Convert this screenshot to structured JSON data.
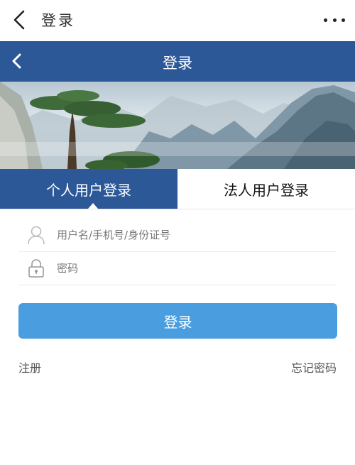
{
  "top_bar": {
    "title": "登录",
    "back_icon": "chevron-left-icon",
    "more_icon": "more-dots-icon"
  },
  "nav_bar": {
    "title": "登录",
    "back_icon": "chevron-left-icon"
  },
  "tabs": [
    {
      "label": "个人用户登录",
      "active": true
    },
    {
      "label": "法人用户登录",
      "active": false
    }
  ],
  "form": {
    "username": {
      "placeholder": "用户名/手机号/身份证号",
      "value": "",
      "icon": "user-icon"
    },
    "password": {
      "placeholder": "密码",
      "value": "",
      "icon": "lock-icon"
    },
    "submit_label": "登录"
  },
  "links": {
    "register": "注册",
    "forgot_password": "忘记密码"
  },
  "colors": {
    "primary": "#2c5898",
    "button": "#4a9ee0"
  }
}
